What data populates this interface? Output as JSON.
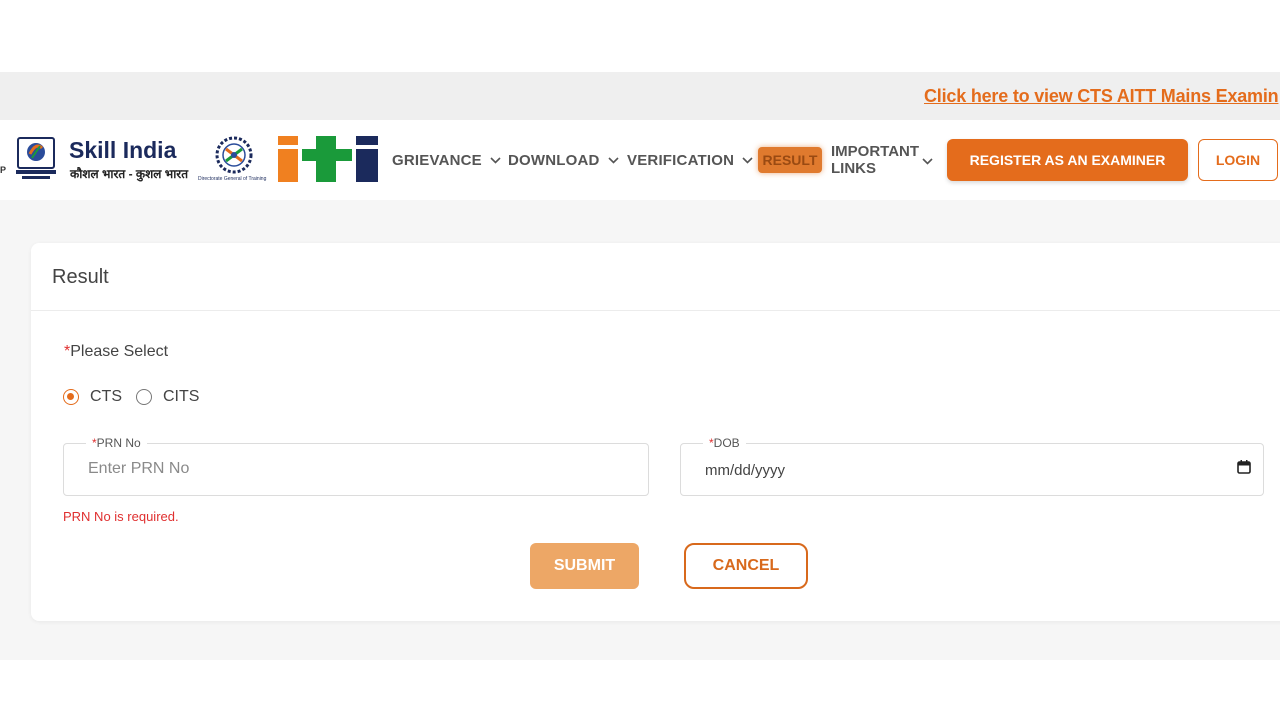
{
  "ticker": {
    "text": "Click here to view CTS AITT Mains Examin"
  },
  "header": {
    "skill_india_title": "Skill India",
    "skill_india_tagline": "कौशल भारत - कुशल भारत",
    "dgt_caption": "Directorate General of Training",
    "iti_logo": "iti",
    "partial_left": "P"
  },
  "nav": {
    "grievance": "GRIEVANCE",
    "download": "DOWNLOAD",
    "verification": "VERIFICATION",
    "result": "RESULT",
    "important_line1": "IMPORTANT",
    "important_line2": "LINKS",
    "register": "REGISTER AS AN EXAMINER",
    "login": "LOGIN"
  },
  "form": {
    "title": "Result",
    "please_select": "Please Select",
    "required_mark": "*",
    "options": [
      "CTS",
      "CITS"
    ],
    "selected_option": "CTS",
    "prn_label": "PRN No",
    "prn_placeholder": "Enter PRN No",
    "dob_label": "DOB",
    "dob_value": "mm/dd/yyyy",
    "error": "PRN No is required.",
    "submit": "SUBMIT",
    "cancel": "CANCEL"
  },
  "colors": {
    "accent": "#e46c1c",
    "submit_disabled": "#eda766",
    "error": "#e03030",
    "iti_orange": "#f08020",
    "iti_green": "#1a9a3a",
    "iti_navy": "#1b2a5c"
  }
}
